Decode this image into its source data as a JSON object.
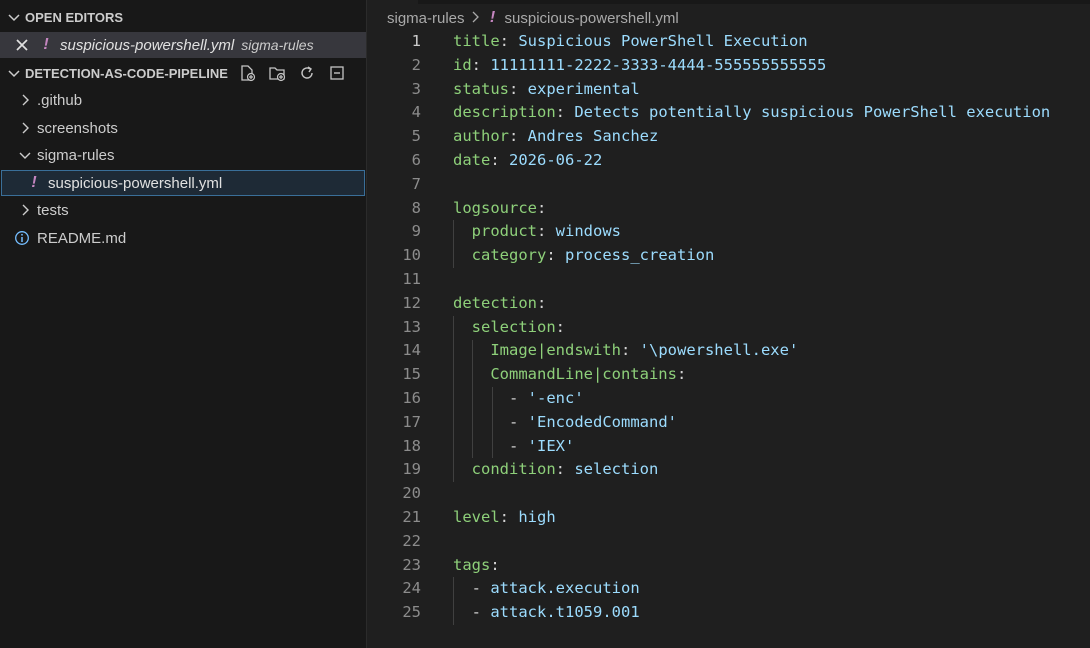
{
  "sidebar": {
    "open_editors_header": "OPEN EDITORS",
    "open_editor": {
      "filename": "suspicious-powershell.yml",
      "folder": "sigma-rules"
    },
    "project_header": "DETECTION-AS-CODE-PIPELINE",
    "tree": [
      {
        "label": ".github",
        "type": "folder",
        "expanded": false
      },
      {
        "label": "screenshots",
        "type": "folder",
        "expanded": false
      },
      {
        "label": "sigma-rules",
        "type": "folder",
        "expanded": true
      },
      {
        "label": "suspicious-powershell.yml",
        "type": "yaml-file"
      },
      {
        "label": "tests",
        "type": "folder",
        "expanded": false
      },
      {
        "label": "README.md",
        "type": "info-file"
      }
    ],
    "toolbar_icons": [
      "new-file-icon",
      "new-folder-icon",
      "refresh-icon",
      "collapse-all-icon"
    ]
  },
  "editor": {
    "breadcrumb": {
      "folder": "sigma-rules",
      "file": "suspicious-powershell.yml"
    },
    "active_line": 1,
    "lines": [
      "1",
      "2",
      "3",
      "4",
      "5",
      "6",
      "7",
      "8",
      "9",
      "10",
      "11",
      "12",
      "13",
      "14",
      "15",
      "16",
      "17",
      "18",
      "19",
      "20",
      "21",
      "22",
      "23",
      "24",
      "25"
    ],
    "code": {
      "title_key": "title",
      "title_val": "Suspicious PowerShell Execution",
      "id_key": "id",
      "id_val": "11111111-2222-3333-4444-555555555555",
      "status_key": "status",
      "status_val": "experimental",
      "description_key": "description",
      "description_val": "Detects potentially suspicious PowerShell execution",
      "author_key": "author",
      "author_val": "Andres Sanchez",
      "date_key": "date",
      "date_val": "2026-06-22",
      "logsource_key": "logsource",
      "product_key": "product",
      "product_val": "windows",
      "category_key": "category",
      "category_val": "process_creation",
      "detection_key": "detection",
      "selection_key": "selection",
      "image_key": "Image|endswith",
      "image_val": "'\\powershell.exe'",
      "cmdline_key": "CommandLine|contains",
      "item1": "'-enc'",
      "item2": "'EncodedCommand'",
      "item3": "'IEX'",
      "condition_key": "condition",
      "condition_val": "selection",
      "level_key": "level",
      "level_val": "high",
      "tags_key": "tags",
      "tag1": "attack.execution",
      "tag2": "attack.t1059.001"
    }
  },
  "colors": {
    "key": "#8ed07a",
    "value": "#9cdcfe",
    "accent": "#0078d4",
    "yaml_icon": "#c586c0"
  }
}
